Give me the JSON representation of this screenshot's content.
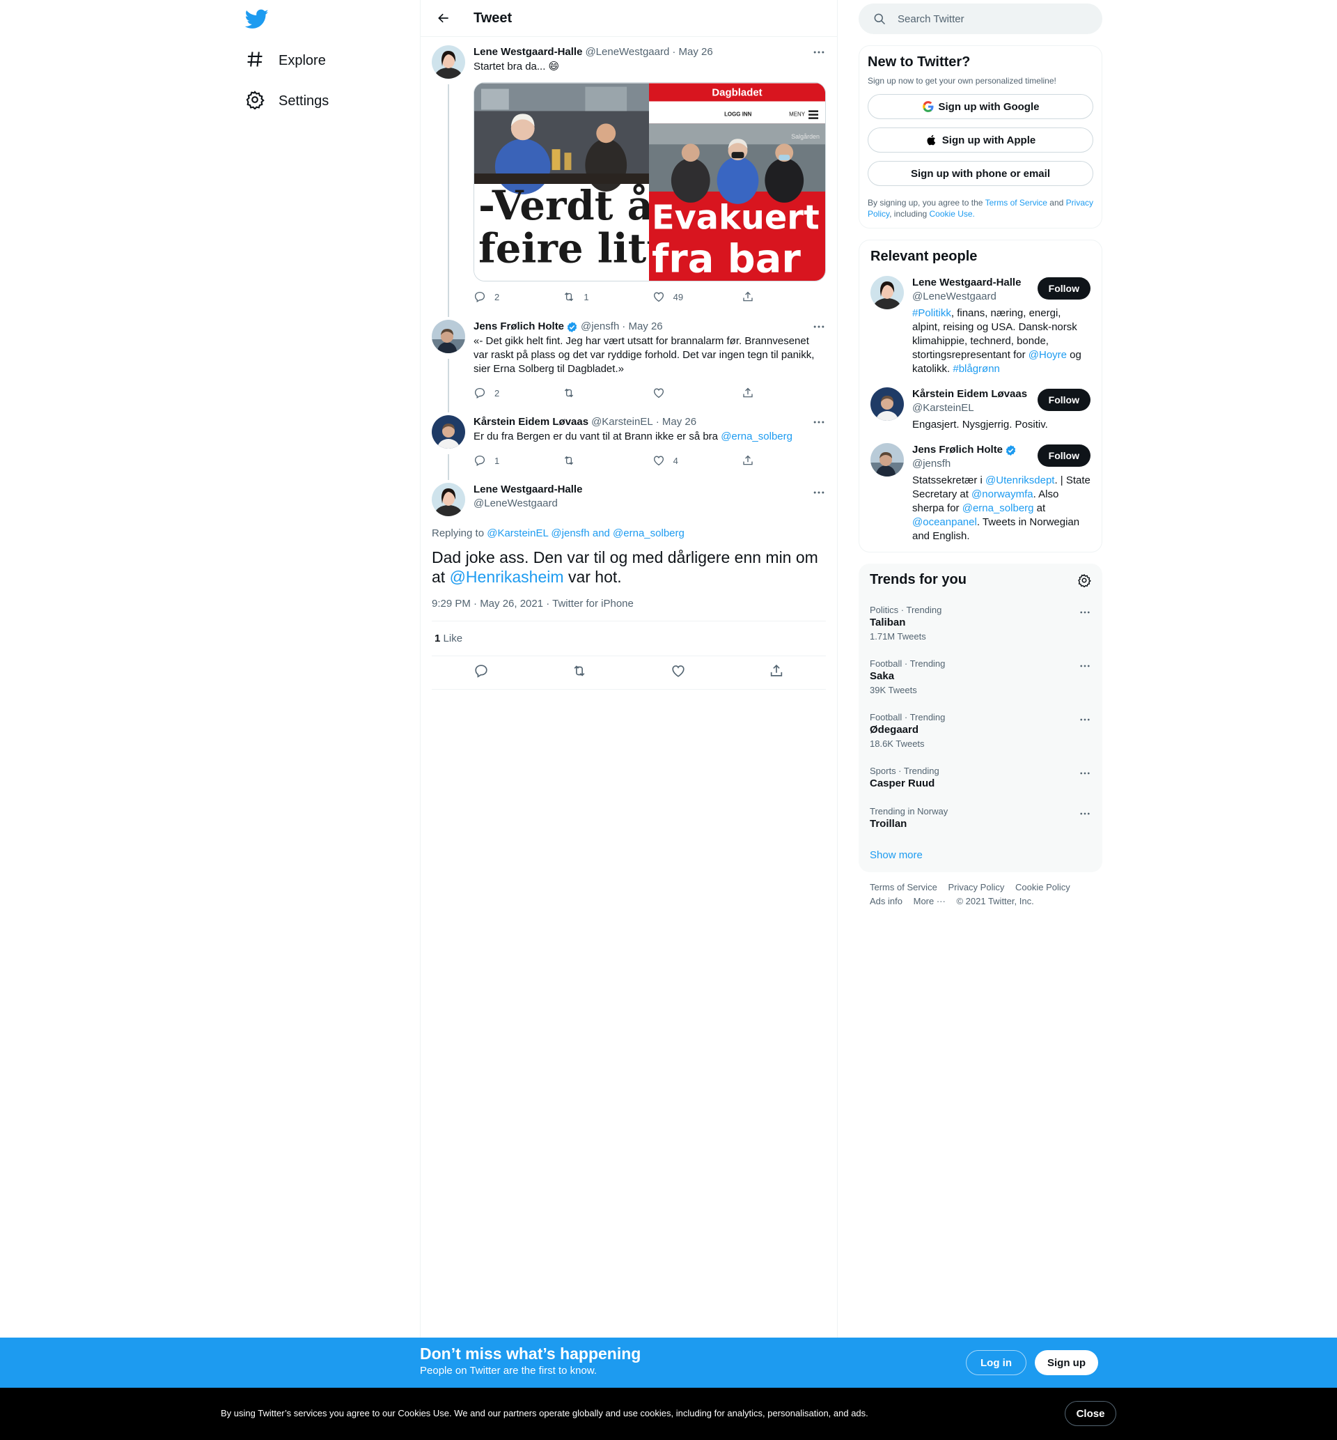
{
  "nav": {
    "explore_label": "Explore",
    "settings_label": "Settings"
  },
  "header": {
    "title": "Tweet"
  },
  "thread": [
    {
      "name": "Lene Westgaard-Halle",
      "handle": "@LeneWestgaard",
      "date": "· May 26",
      "text": "Startet bra da... 😄",
      "media": {
        "left_headline_1": "-Verdt å",
        "left_headline_2": "feire litt",
        "right_brand": "Dagbladet",
        "right_login": "LOGG INN",
        "right_menu": "MENY",
        "right_sign": "Salgården",
        "right_headline_1": "Evakuert",
        "right_headline_2": "fra bar"
      },
      "replies": "2",
      "retweets": "1",
      "likes": "49"
    },
    {
      "name": "Jens Frølich Holte",
      "handle": "@jensfh",
      "date": "· May 26",
      "text": "«- Det gikk helt fint. Jeg har vært utsatt for brannalarm før. Brannvesenet var raskt på plass og det var ryddige forhold. Det var ingen tegn til panikk, sier Erna Solberg til Dagbladet.»",
      "replies": "2",
      "retweets": "",
      "likes": ""
    },
    {
      "name": "Kårstein Eidem Løvaas",
      "handle": "@KarsteinEL",
      "date": "· May 26",
      "text_prefix": "Er du fra Bergen er du vant til at Brann ikke er så bra ",
      "text_mention": "@erna_solberg",
      "replies": "1",
      "retweets": "",
      "likes": "4"
    }
  ],
  "focus": {
    "name": "Lene Westgaard-Halle",
    "handle": "@LeneWestgaard",
    "replying_label": "Replying to",
    "replying_to": "@KarsteinEL @jensfh and @erna_solberg",
    "text_1": "Dad joke ass. Den var til og med dårligere enn min om at",
    "text_mention": "@Henrikasheim",
    "text_2": "var hot.",
    "timestamp": "9:29 PM · May 26, 2021 · Twitter for iPhone",
    "likes_count": "1",
    "likes_label": "Like"
  },
  "search": {
    "placeholder": "Search Twitter"
  },
  "signup": {
    "title": "New to Twitter?",
    "subtitle": "Sign up now to get your own personalized timeline!",
    "google": "Sign up with Google",
    "apple": "Sign up with Apple",
    "phone": "Sign up with phone or email",
    "legal_1": "By signing up, you agree to the",
    "tos": "Terms of Service",
    "legal_2": "and",
    "privacy": "Privacy Policy",
    "legal_3": ", including",
    "cookie": "Cookie Use."
  },
  "people": {
    "title": "Relevant people",
    "follow_label": "Follow",
    "items": [
      {
        "name": "Lene Westgaard-Halle",
        "handle": "@LeneWestgaard",
        "bio_html_parts": [
          "#Politikk",
          ", finans, næring, energi, alpint, reising og USA. Dansk-norsk klimahippie, technerd, bonde, stortingsrepresentant for ",
          "@Hoyre",
          " og katolikk. ",
          "#blågrønn"
        ]
      },
      {
        "name": "Kårstein Eidem Løvaas",
        "handle": "@KarsteinEL",
        "bio": "Engasjert. Nysgjerrig. Positiv."
      },
      {
        "name": "Jens Frølich Holte",
        "handle": "@jensfh",
        "bio_parts": [
          "Statssekretær i ",
          "@Utenriksdept",
          ". | State Secretary at ",
          "@norwaymfa",
          ". Also sherpa for ",
          "@erna_solberg",
          " at ",
          "@oceanpanel",
          ". Tweets in Norwegian and English."
        ]
      }
    ]
  },
  "trends": {
    "title": "Trends for you",
    "items": [
      {
        "context": "Politics · Trending",
        "name": "Taliban",
        "count": "1.71M Tweets"
      },
      {
        "context": "Football · Trending",
        "name": "Saka",
        "count": "39K Tweets"
      },
      {
        "context": "Football · Trending",
        "name": "Ødegaard",
        "count": "18.6K Tweets"
      },
      {
        "context": "Sports · Trending",
        "name": "Casper Ruud",
        "count": ""
      },
      {
        "context": "Trending in Norway",
        "name": "Troillan",
        "count": ""
      }
    ],
    "show_more": "Show more"
  },
  "footer": {
    "tos": "Terms of Service",
    "privacy": "Privacy Policy",
    "cookie": "Cookie Policy",
    "ads": "Ads info",
    "more": "More ···",
    "copyright": "© 2021 Twitter, Inc."
  },
  "banner": {
    "title": "Don’t miss what’s happening",
    "subtitle": "People on Twitter are the first to know.",
    "login": "Log in",
    "signup": "Sign up"
  },
  "cookies": {
    "message": "By using Twitter’s services you agree to our Cookies Use. We and our partners operate globally and use cookies, including for analytics, personalisation, and ads.",
    "close": "Close"
  },
  "colors": {
    "accent": "#1d9bf0",
    "text": "#0f1419",
    "muted": "#536471",
    "dagbladet_red": "#d8151f"
  }
}
